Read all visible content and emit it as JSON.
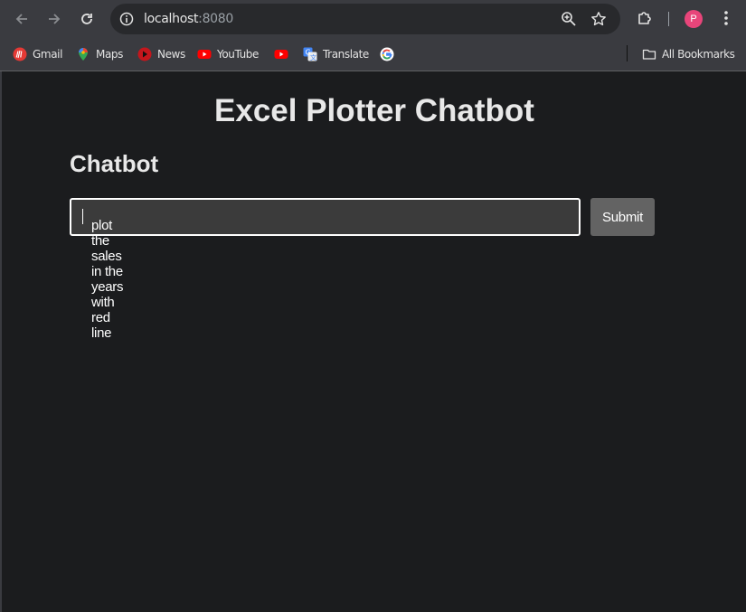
{
  "browser": {
    "url_host": "localhost",
    "url_port": ":8080",
    "profile_initial": "P"
  },
  "bookmarks": {
    "items": [
      {
        "label": "Gmail",
        "icon": "gmail-icon"
      },
      {
        "label": "Maps",
        "icon": "maps-icon"
      },
      {
        "label": "News",
        "icon": "news-icon"
      },
      {
        "label": "YouTube",
        "icon": "youtube-icon"
      },
      {
        "label": "",
        "icon": "youtube-icon"
      },
      {
        "label": "Translate",
        "icon": "translate-icon"
      },
      {
        "label": "",
        "icon": "google-icon"
      }
    ],
    "all_bookmarks_label": "All Bookmarks"
  },
  "page": {
    "title": "Excel Plotter Chatbot",
    "section_heading": "Chatbot",
    "input_value": "plot the sales in the years with red line",
    "submit_label": "Submit"
  },
  "colors": {
    "background": "#1b1c1e",
    "toolbar": "#3a3b40",
    "profile": "#e8457a",
    "button": "#636363"
  }
}
